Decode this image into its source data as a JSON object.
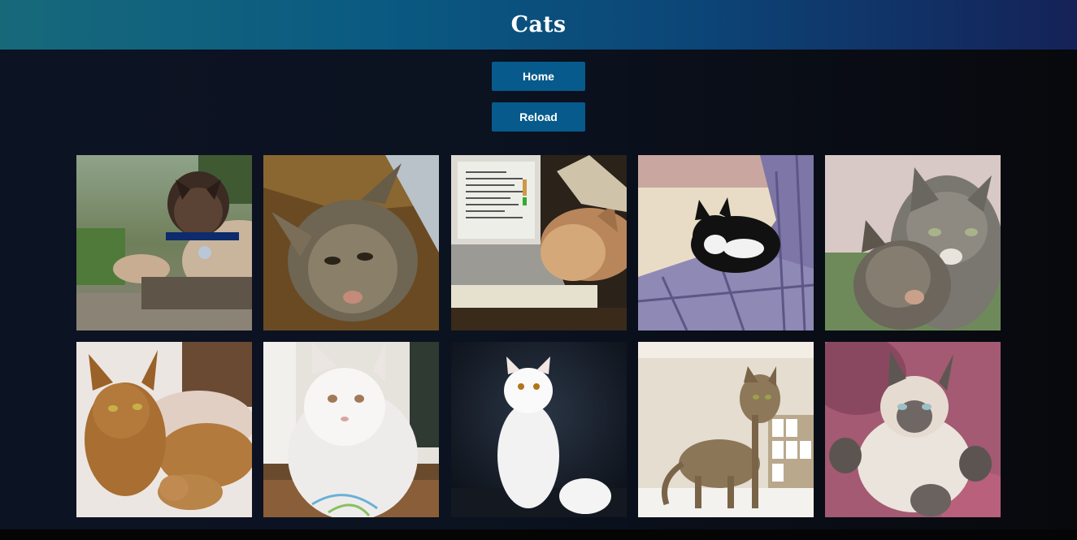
{
  "header": {
    "title": "Cats"
  },
  "buttons": {
    "home_label": "Home",
    "reload_label": "Reload"
  },
  "colors": {
    "header_gradient": [
      "#17697a",
      "#0a5a82",
      "#152258"
    ],
    "button_bg": "#065a8c",
    "page_bg": "#0b1220"
  },
  "gallery": {
    "images": [
      {
        "subject": "siamese-cat-outdoors"
      },
      {
        "subject": "tabby-cat-in-box"
      },
      {
        "subject": "cat-beside-laptop"
      },
      {
        "subject": "black-white-cat-on-bed"
      },
      {
        "subject": "two-tabby-cats"
      },
      {
        "subject": "abyssinian-cat-with-kitten"
      },
      {
        "subject": "white-persian-cat-on-floor"
      },
      {
        "subject": "white-persian-cat-dark-backdrop"
      },
      {
        "subject": "ruddy-cat-standing"
      },
      {
        "subject": "siamese-cat-lying-on-back"
      }
    ]
  }
}
